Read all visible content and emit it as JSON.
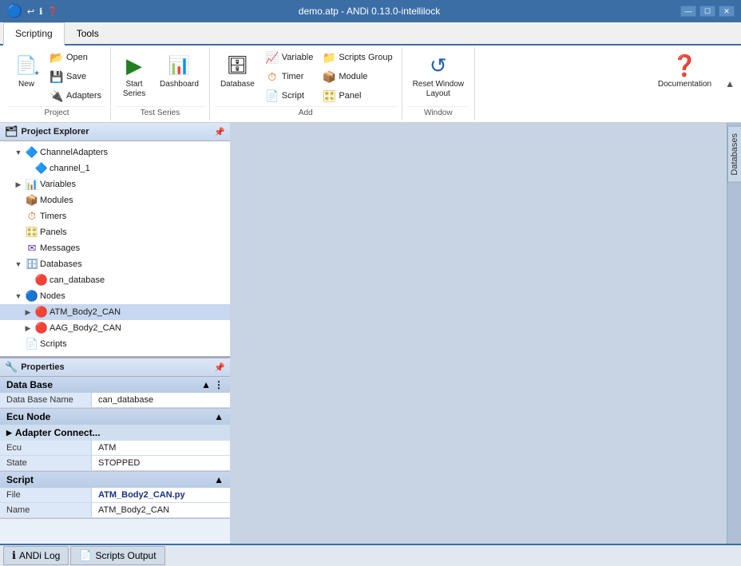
{
  "titleBar": {
    "title": "demo.atp - ANDi 0.13.0-intellilock",
    "minBtn": "—",
    "maxBtn": "☐",
    "closeBtn": "✕"
  },
  "ribbonTabs": [
    {
      "label": "Scripting",
      "active": true
    },
    {
      "label": "Tools",
      "active": false
    }
  ],
  "ribbonGroups": {
    "project": {
      "label": "Project",
      "newBtn": "New",
      "openBtn": "Open",
      "saveBtn": "Save",
      "adaptersBtn": "Adapters"
    },
    "testSeries": {
      "label": "Test Series",
      "startSeriesBtn": "Start\nSeries",
      "dashboardBtn": "Dashboard"
    },
    "add": {
      "label": "Add",
      "variableBtn": "Variable",
      "timerBtn": "Timer",
      "databaseBtn": "Database",
      "scriptBtn": "Script",
      "scriptsGroupBtn": "Scripts Group",
      "moduleBtn": "Module",
      "panelBtn": "Panel"
    },
    "window": {
      "label": "Window",
      "resetWindowBtn": "Reset Window\nLayout"
    },
    "help": {
      "documentationBtn": "Documentation"
    }
  },
  "projectExplorer": {
    "title": "Project Explorer",
    "pinIcon": "📌",
    "items": [
      {
        "level": 1,
        "label": "ChannelAdapters",
        "icon": "🔷",
        "hasChevron": true,
        "expanded": true
      },
      {
        "level": 2,
        "label": "channel_1",
        "icon": "🔷",
        "hasChevron": false
      },
      {
        "level": 1,
        "label": "Variables",
        "icon": "📊",
        "hasChevron": true,
        "expanded": false
      },
      {
        "level": 1,
        "label": "Modules",
        "icon": "📦",
        "hasChevron": false
      },
      {
        "level": 1,
        "label": "Timers",
        "icon": "⏱",
        "hasChevron": false
      },
      {
        "level": 1,
        "label": "Panels",
        "icon": "🎛",
        "hasChevron": false
      },
      {
        "level": 1,
        "label": "Messages",
        "icon": "✉",
        "hasChevron": false
      },
      {
        "level": 1,
        "label": "Databases",
        "icon": "🗄",
        "hasChevron": true,
        "expanded": true
      },
      {
        "level": 2,
        "label": "can_database",
        "icon": "🔴",
        "hasChevron": false
      },
      {
        "level": 1,
        "label": "Nodes",
        "icon": "🔵",
        "hasChevron": true,
        "expanded": true
      },
      {
        "level": 2,
        "label": "ATM_Body2_CAN",
        "icon": "🔴",
        "hasChevron": true,
        "expanded": false,
        "selected": true
      },
      {
        "level": 2,
        "label": "AAG_Body2_CAN",
        "icon": "🔴",
        "hasChevron": true,
        "expanded": false
      },
      {
        "level": 1,
        "label": "Scripts",
        "icon": "📄",
        "hasChevron": false
      }
    ]
  },
  "properties": {
    "title": "Properties",
    "pinIcon": "📌",
    "sections": [
      {
        "name": "Data Base",
        "rows": [
          {
            "label": "Data Base Name",
            "value": "can_database"
          }
        ]
      },
      {
        "name": "Ecu Node",
        "subSections": [
          {
            "name": "Adapter Connect...",
            "rows": []
          }
        ],
        "rows": [
          {
            "label": "Ecu",
            "value": "ATM"
          },
          {
            "label": "State",
            "value": "STOPPED"
          }
        ]
      },
      {
        "name": "Script",
        "rows": [
          {
            "label": "File",
            "value": "ATM_Body2_CAN.py"
          },
          {
            "label": "Name",
            "value": "ATM_Body2_CAN"
          }
        ]
      }
    ]
  },
  "rightSidebar": {
    "tabLabel": "Databases"
  },
  "bottomTabs": [
    {
      "label": "ANDi Log",
      "icon": "ℹ"
    },
    {
      "label": "Scripts Output",
      "icon": "📄"
    }
  ]
}
